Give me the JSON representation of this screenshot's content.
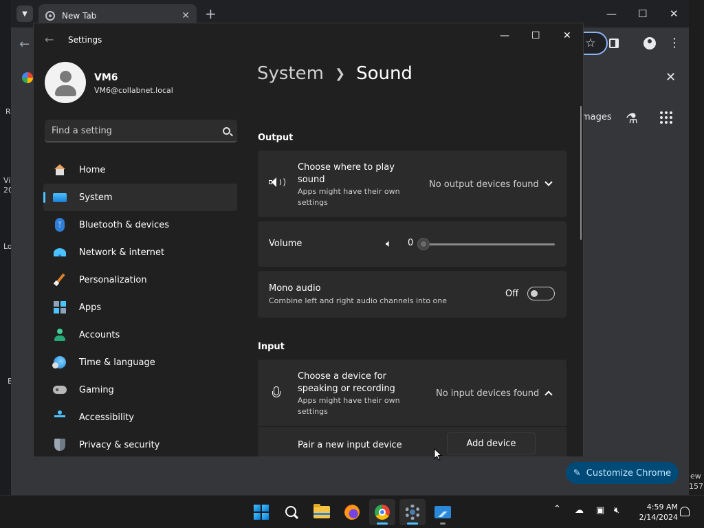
{
  "chrome": {
    "tab_title": "New Tab",
    "ntp_images_fragment": "mages",
    "customize_label": "Customize Chrome",
    "right_fragments": [
      "ew",
      "157"
    ]
  },
  "desktop": {
    "left_fragments": [
      "R",
      "Vi",
      "20",
      "Lo",
      "E"
    ]
  },
  "settings": {
    "window_title": "Settings",
    "profile": {
      "name": "VM6",
      "email": "VM6@collabnet.local"
    },
    "search": {
      "placeholder": "Find a setting"
    },
    "nav": [
      {
        "label": "Home",
        "icon": "home-icon"
      },
      {
        "label": "System",
        "icon": "system-icon",
        "selected": true
      },
      {
        "label": "Bluetooth & devices",
        "icon": "bluetooth-icon"
      },
      {
        "label": "Network & internet",
        "icon": "wifi-icon"
      },
      {
        "label": "Personalization",
        "icon": "brush-icon"
      },
      {
        "label": "Apps",
        "icon": "apps-icon"
      },
      {
        "label": "Accounts",
        "icon": "account-icon"
      },
      {
        "label": "Time & language",
        "icon": "globe-clock-icon"
      },
      {
        "label": "Gaming",
        "icon": "gamepad-icon"
      },
      {
        "label": "Accessibility",
        "icon": "accessibility-icon"
      },
      {
        "label": "Privacy & security",
        "icon": "shield-icon"
      }
    ],
    "breadcrumb": {
      "parent": "System",
      "current": "Sound"
    },
    "output": {
      "heading": "Output",
      "choose_title": "Choose where to play sound",
      "choose_sub": "Apps might have their own settings",
      "choose_value": "No output devices found",
      "volume_label": "Volume",
      "volume_value": "0",
      "mono_title": "Mono audio",
      "mono_sub": "Combine left and right audio channels into one",
      "mono_state": "Off"
    },
    "input": {
      "heading": "Input",
      "choose_title": "Choose a device for speaking or recording",
      "choose_sub": "Apps might have their own settings",
      "choose_value": "No input devices found",
      "pair_label": "Pair a new input device",
      "add_button": "Add device"
    }
  },
  "taskbar": {
    "time": "4:59 AM",
    "date": "2/14/2024"
  },
  "colors": {
    "accent": "#4cc2ff",
    "window_bg": "#202020",
    "card_bg": "#2b2b2b",
    "customize_bg": "#004a77"
  }
}
